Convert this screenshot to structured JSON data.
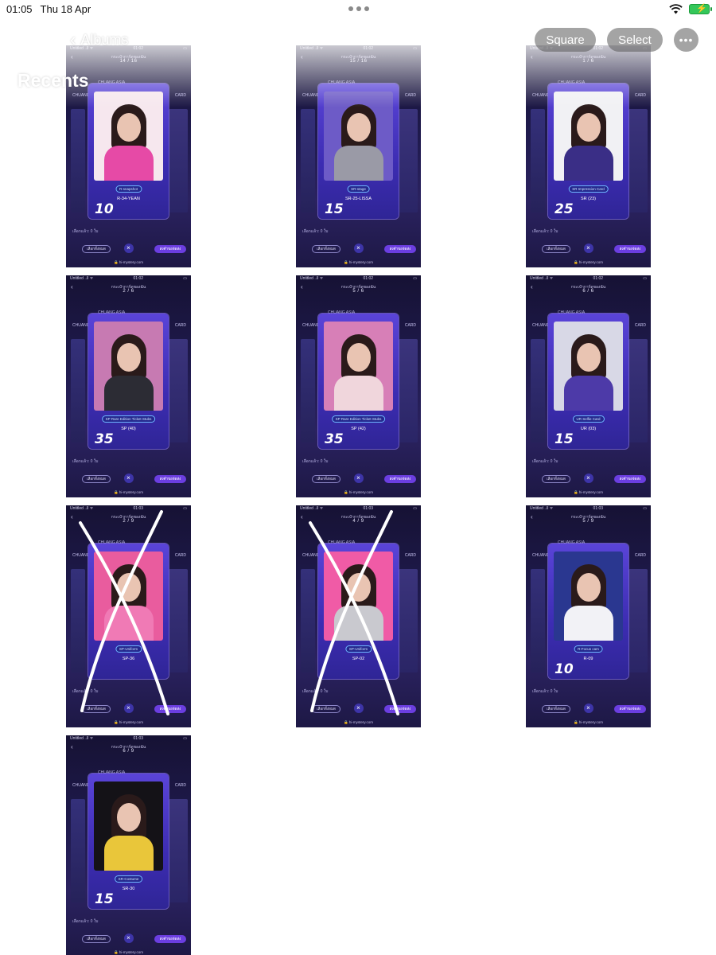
{
  "status_bar": {
    "time": "01:05",
    "date": "Thu 18 Apr",
    "multitask_icon": "three-dots-icon",
    "wifi_icon": "wifi-icon",
    "battery_icon": "battery-charging-icon"
  },
  "nav": {
    "sidebar_icon": "sidebar-icon",
    "back_label": "Albums",
    "square_label": "Square",
    "select_label": "Select",
    "more_icon": "ellipsis-icon",
    "more_glyph": "•••"
  },
  "title": "Recents",
  "thumb_common": {
    "statusbar_left": "Untitled ..ll ᯤ",
    "header_text": "กระเป๋าการ์ดของฉัน",
    "section_label": "CHUANG ASIA",
    "side_left": "CHUANG",
    "side_right": "CARD",
    "bottom_info": "เลือกแล้ว: 0 ใบ",
    "btn_left": "เลือกทั้งหมด",
    "btn_right": "ส่งคำขอจัดส่ง",
    "close": "×",
    "url": "🔒 hi-mystery.com"
  },
  "thumbnails": [
    {
      "time": "01:02",
      "counter": "14 / 16",
      "card_type": "R-snapshot",
      "card_name": "R-34-YEAN",
      "qty": "10",
      "photo_bg": "#f6e7ee",
      "body": "#e64aa6",
      "crossed": false
    },
    {
      "time": "01:02",
      "counter": "15 / 16",
      "card_type": "SR-stage",
      "card_name": "SR-25-LISSA",
      "qty": "15",
      "photo_bg": "#6d5bc7",
      "body": "#9a9aa6",
      "crossed": false
    },
    {
      "time": "01:02",
      "counter": "1 / 6",
      "card_type": "SR Impression Card",
      "card_name": "SR (23)",
      "qty": "25",
      "photo_bg": "#f1f1f4",
      "body": "#3a2e86",
      "crossed": false
    },
    {
      "time": "01:02",
      "counter": "2 / 6",
      "card_type": "SP Rare Edition Ticket Stubs",
      "card_name": "SP (40)",
      "qty": "35",
      "photo_bg": "#c77ab2",
      "body": "#2c2c34",
      "crossed": false
    },
    {
      "time": "01:02",
      "counter": "5 / 6",
      "card_type": "SP Rare Edition Ticket Stubs",
      "card_name": "SP (42)",
      "qty": "35",
      "photo_bg": "#d77fb7",
      "body": "#f0d6dc",
      "crossed": false
    },
    {
      "time": "01:02",
      "counter": "6 / 6",
      "card_type": "UR Selfie Card",
      "card_name": "UR (03)",
      "qty": "15",
      "photo_bg": "#d8d8e6",
      "body": "#4d3aa8",
      "crossed": false
    },
    {
      "time": "01:03",
      "counter": "2 / 9",
      "card_type": "SP-Uniform",
      "card_name": "SP-36",
      "qty": "",
      "photo_bg": "#e95c9e",
      "body": "#f07ab5",
      "crossed": true
    },
    {
      "time": "01:03",
      "counter": "4 / 9",
      "card_type": "SP-Uniform",
      "card_name": "SP-02",
      "qty": "",
      "photo_bg": "#f05ba6",
      "body": "#c9c9cf",
      "crossed": true
    },
    {
      "time": "01:03",
      "counter": "5 / 9",
      "card_type": "R-Focus cam",
      "card_name": "R-09",
      "qty": "10",
      "photo_bg": "#2a3790",
      "body": "#f2f2f6",
      "crossed": false
    },
    {
      "time": "01:03",
      "counter": "6 / 9",
      "card_type": "SR-Costume",
      "card_name": "SR-30",
      "qty": "15",
      "photo_bg": "#141217",
      "body": "#e9c63a",
      "crossed": false
    }
  ]
}
